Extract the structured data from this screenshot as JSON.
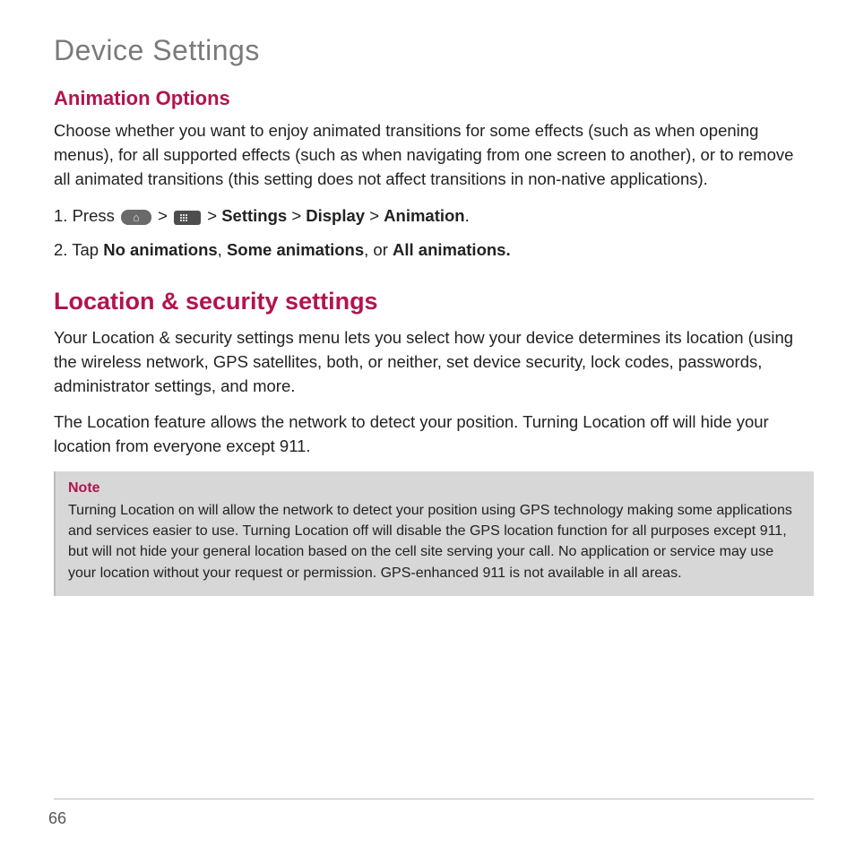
{
  "page_title": "Device Settings",
  "page_number": "66",
  "animation": {
    "heading": "Animation Options",
    "intro": "Choose whether you want to enjoy animated transitions for some effects (such as when opening menus), for all supported effects (such as when navigating from one screen to another), or to remove all animated transitions (this setting does not affect transitions in non-native applications).",
    "step1_prefix": "1. Press ",
    "step1_sep": "  >  ",
    "step1_sep2": "  > ",
    "step1_settings": "Settings",
    "step1_display": "Display",
    "step1_animation": "Animation",
    "step1_gt": " > ",
    "step1_period": ".",
    "step2_prefix": "2. Tap ",
    "step2_opt1": "No animations",
    "step2_comma1": ", ",
    "step2_opt2": "Some animations",
    "step2_comma2": ", or ",
    "step2_opt3": "All animations."
  },
  "location": {
    "heading": "Location & security settings",
    "p1": "Your Location & security settings menu lets you select how your device determines its location (using the wireless network, GPS satellites, both, or neither, set device security, lock codes, passwords, administrator settings, and more.",
    "p2": "The Location feature allows the network to detect your position. Turning Location off will hide your location from everyone except 911.",
    "note_title": "Note",
    "note_body": "Turning Location on will allow the network to detect your position using GPS technology making some applications and services easier to use. Turning Location off will disable the GPS location function for all purposes except 911, but will not hide your general location based on the cell site serving your call. No application or service may use your location without your request or permission. GPS-enhanced 911 is not available in all areas."
  }
}
